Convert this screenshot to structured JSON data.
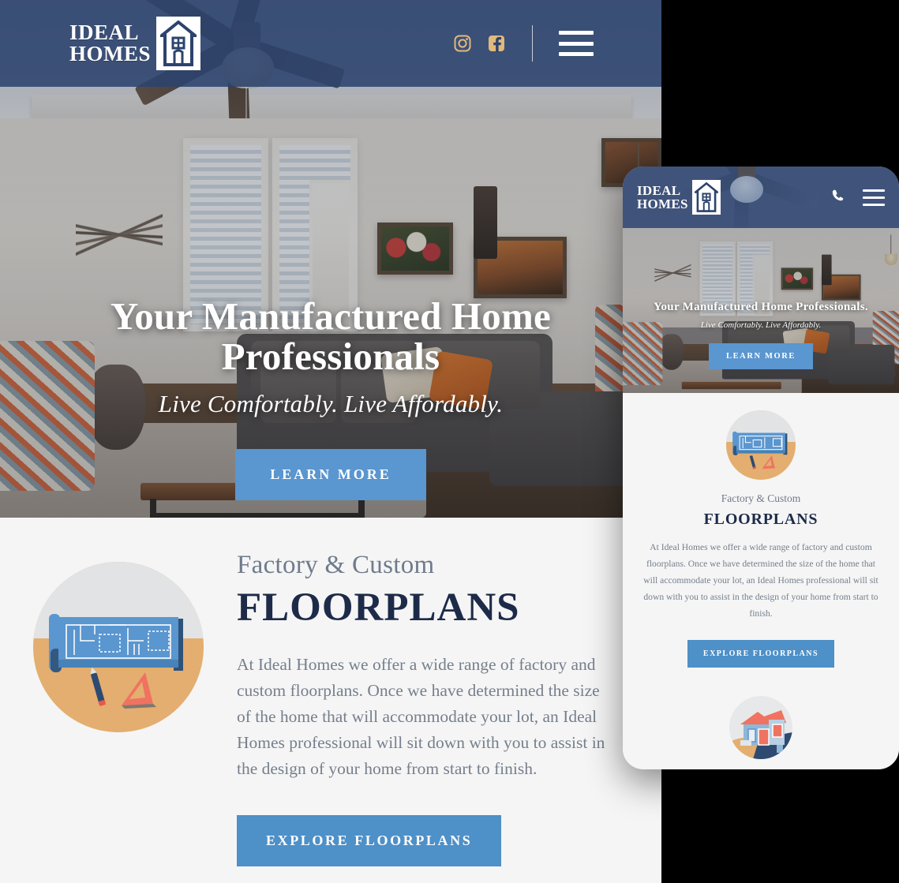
{
  "colors": {
    "header_navy": "#2c436e",
    "button_blue": "#5a96cf",
    "explore_blue": "#4e90c8",
    "headline_navy": "#1d2b49",
    "eyebrow_gray": "#6f7b8c",
    "body_gray": "#757f8c",
    "social_gold": "#e0b97d",
    "section_bg": "#f5f5f5",
    "icon_tan": "#e3ae6f",
    "icon_gray": "#e2e3e4",
    "page_backdrop": "#000000"
  },
  "desktop": {
    "header": {
      "logo": {
        "line1": "IDEAL",
        "line2": "HOMES",
        "mark_icon": "house-icon"
      },
      "social": [
        {
          "name": "instagram-icon",
          "label": "Instagram"
        },
        {
          "name": "facebook-icon",
          "label": "Facebook"
        }
      ],
      "menu_icon": "hamburger-menu-icon"
    },
    "hero": {
      "title": "Your Manufactured Home Professionals",
      "subtitle": "Live Comfortably. Live Affordably.",
      "cta": "LEARN MORE"
    },
    "floorplans": {
      "icon": "blueprint-floorplan-icon",
      "eyebrow": "Factory & Custom",
      "headline": "FLOORPLANS",
      "paragraph": "At Ideal Homes we offer a wide range of factory and custom floorplans. Once we have determined the size of the home that will accommodate your lot, an Ideal Homes professional will sit down with you to assist in the design of your home from start to finish.",
      "cta": "EXPLORE FLOORPLANS"
    }
  },
  "mobile": {
    "header": {
      "logo": {
        "line1": "IDEAL",
        "line2": "HOMES",
        "mark_icon": "house-icon"
      },
      "phone_icon": "phone-icon",
      "menu_icon": "hamburger-menu-icon"
    },
    "hero": {
      "title": "Your Manufactured Home Professionals.",
      "subtitle": "Live Comfortably. Live Affordably.",
      "cta": "LEARN MORE"
    },
    "floorplans": {
      "icon": "blueprint-floorplan-icon",
      "eyebrow": "Factory & Custom",
      "headline": "FLOORPLANS",
      "paragraph": "At Ideal Homes we offer a wide range of factory and custom floorplans. Once we have determined the size of the home that will accommodate your lot, an Ideal Homes professional will sit down with you to assist in the design of your home from start to finish.",
      "cta": "EXPLORE FLOORPLANS"
    },
    "next_section": {
      "icon": "house-illustration-icon"
    }
  }
}
